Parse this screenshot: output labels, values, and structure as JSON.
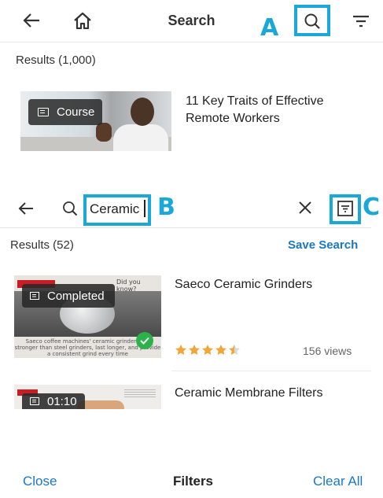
{
  "top_panel": {
    "title": "Search",
    "callout_a": "A",
    "results_count": "Results (1,000)",
    "item": {
      "badge": "Course",
      "title": "11 Key Traits of Effective Remote Workers"
    }
  },
  "bottom_panel": {
    "search_value": "Ceramic",
    "callout_b": "B",
    "callout_c": "C",
    "results_count": "Results (52)",
    "save_search": "Save Search",
    "items": [
      {
        "badge": "Completed",
        "title": "Saeco Ceramic Grinders",
        "rating": 4.5,
        "views": "156 views",
        "thumb_tag": "Did you know?",
        "thumb_caption": "Saeco coffee machines' ceramic grinders are stronger than steel grinders, last longer, and provide a consistent grind every time"
      },
      {
        "badge": "01:10",
        "title": "Ceramic Membrane Filters"
      }
    ],
    "footer": {
      "close": "Close",
      "title": "Filters",
      "clear_all": "Clear All"
    }
  },
  "colors": {
    "callout": "#1aa8d8",
    "link": "#1a78c2",
    "star": "#f0a63a",
    "check": "#2cb24a"
  }
}
